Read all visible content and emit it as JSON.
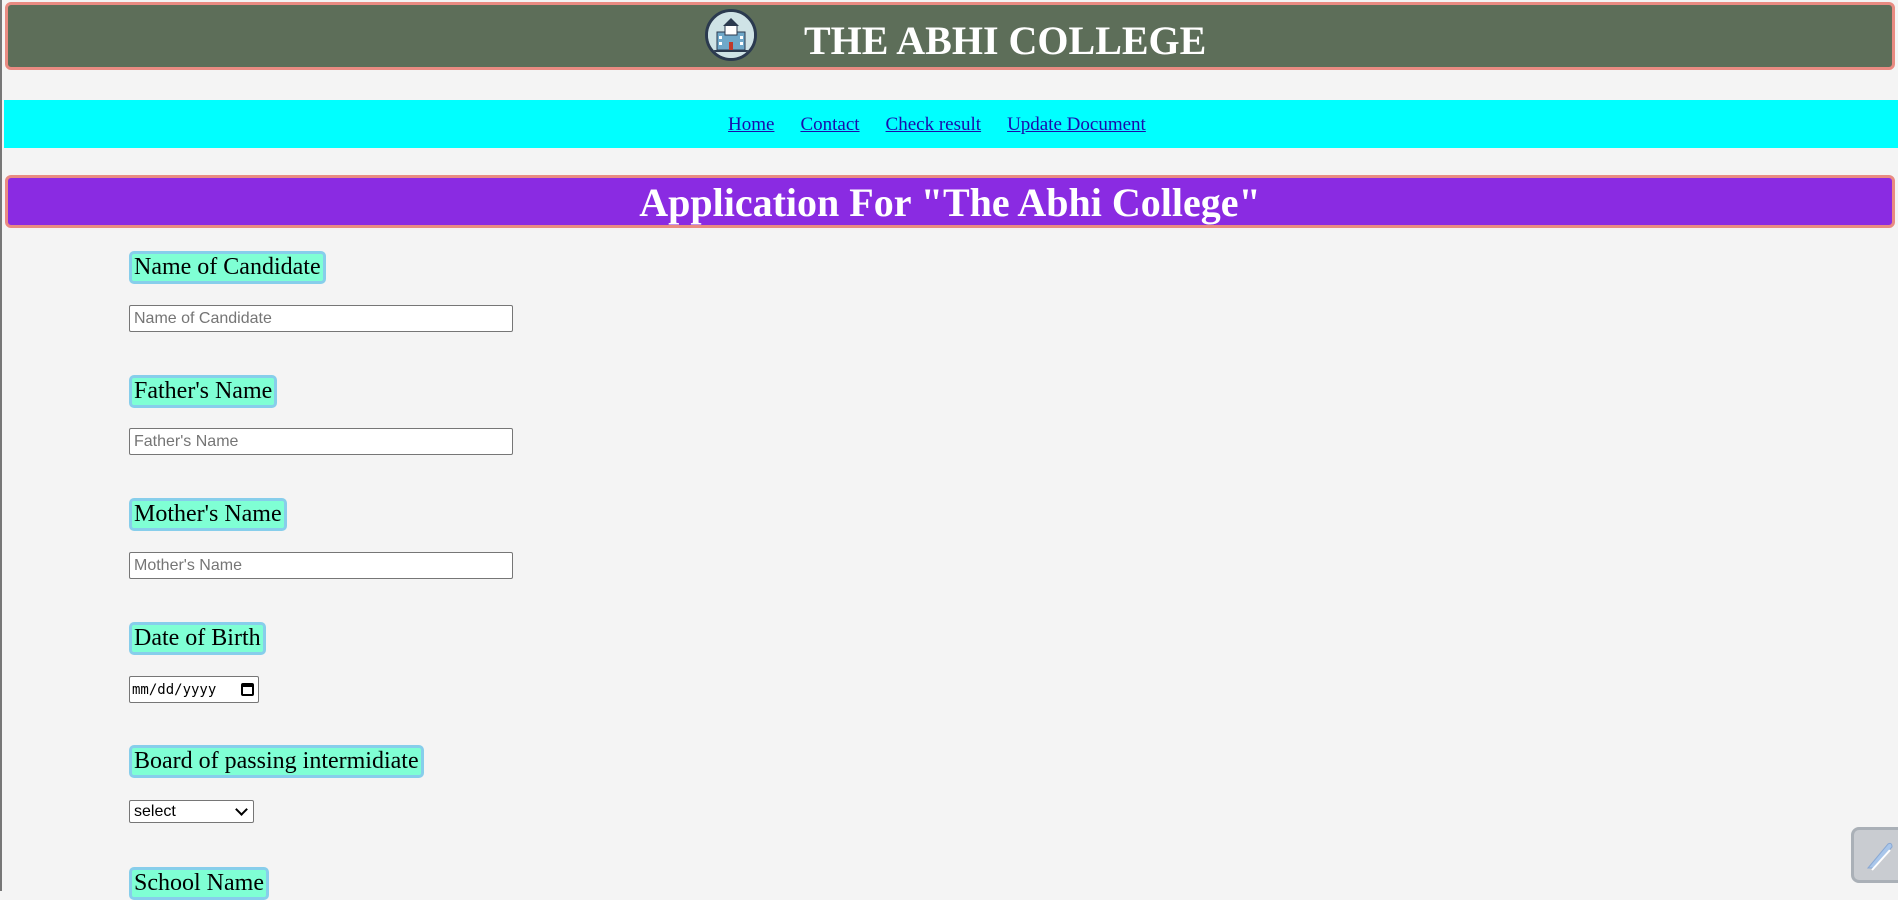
{
  "header": {
    "title": "THE ABHI COLLEGE",
    "logo_icon": "college-building-icon",
    "background": "#5d6e59",
    "border_color": "#e98b82"
  },
  "nav": {
    "background": "#00ffff",
    "items": [
      {
        "label": "Home"
      },
      {
        "label": "Contact"
      },
      {
        "label": "Check result"
      },
      {
        "label": "Update Document"
      }
    ]
  },
  "banner": {
    "title": "Application For \"The Abhi College\"",
    "background": "#8a2be2"
  },
  "form": {
    "label_background": "#7fffd4",
    "label_border": "#87ceeb",
    "name_of_candidate": {
      "label": "Name of Candidate",
      "placeholder": "Name of Candidate",
      "value": ""
    },
    "fathers_name": {
      "label": "Father's Name",
      "placeholder": "Father's Name",
      "value": ""
    },
    "mothers_name": {
      "label": "Mother's Name",
      "placeholder": "Mother's Name",
      "value": ""
    },
    "date_of_birth": {
      "label": "Date of Birth",
      "format": "mm/dd/yyyy"
    },
    "board": {
      "label": "Board of passing intermidiate",
      "selected": "select"
    },
    "school_name": {
      "label": "School Name"
    }
  },
  "floating_widget": {
    "icon": "feather-icon"
  }
}
